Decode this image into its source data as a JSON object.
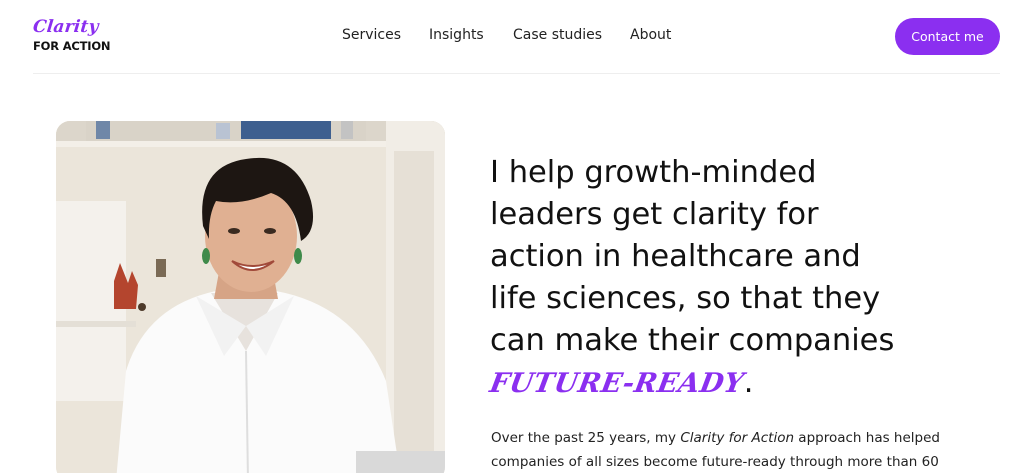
{
  "brand": {
    "logo_script": "Clarity",
    "logo_sub": "FOR ACTION",
    "accent_color": "#8b2ff0"
  },
  "nav": {
    "items": [
      "Services",
      "Insights",
      "Case studies",
      "About"
    ],
    "cta_label": "Contact me"
  },
  "hero": {
    "headline_lines": [
      "I help growth-minded",
      "leaders get clarity for",
      "action in healthcare and",
      "life sciences, so that they",
      "can make their companies"
    ],
    "headline_accent": "FUTURE-READY",
    "headline_end": ".",
    "intro_part1": "Over the past 25 years, my ",
    "intro_em": "Clarity for Action",
    "intro_part2": " approach has helped",
    "intro_line2": "companies of all sizes become future-ready through more than 60"
  }
}
